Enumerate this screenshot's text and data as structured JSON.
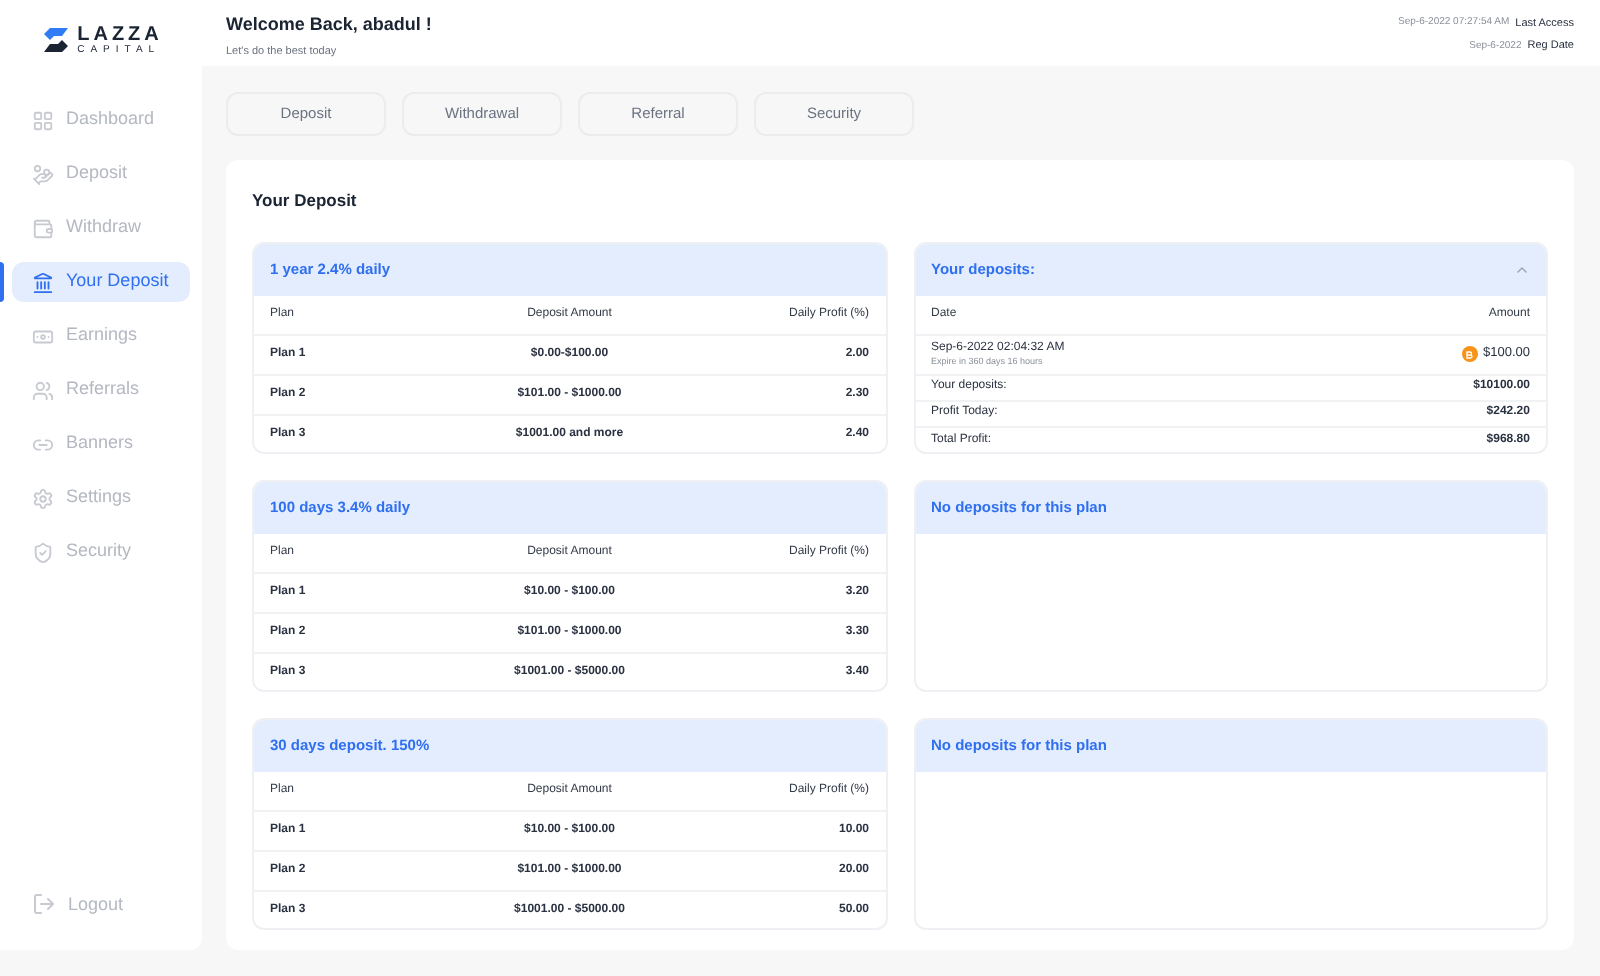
{
  "logo": {
    "name": "LAZZA",
    "tagline": "CAPITAL"
  },
  "header": {
    "title": "Welcome Back, abadul !",
    "subtitle": "Let's do the best today",
    "meta": [
      {
        "value": "Sep-6-2022 07:27:54 AM",
        "label": "Last Access"
      },
      {
        "value": "Sep-6-2022",
        "label": "Reg Date"
      }
    ]
  },
  "sidebar": {
    "items": [
      {
        "label": "Dashboard",
        "selected": false
      },
      {
        "label": "Deposit",
        "selected": false
      },
      {
        "label": "Withdraw",
        "selected": false
      },
      {
        "label": "Your Deposit",
        "selected": true
      },
      {
        "label": "Earnings",
        "selected": false
      },
      {
        "label": "Referrals",
        "selected": false
      },
      {
        "label": "Banners",
        "selected": false
      },
      {
        "label": "Settings",
        "selected": false
      },
      {
        "label": "Security",
        "selected": false
      }
    ],
    "logout": "Logout"
  },
  "tabs": [
    {
      "label": "Deposit",
      "selected": false
    },
    {
      "label": "Withdrawal",
      "selected": false
    },
    {
      "label": "Referral",
      "selected": false
    },
    {
      "label": "Security",
      "selected": false
    }
  ],
  "section_title": "Your Deposit",
  "plans": [
    {
      "title": "1 year 2.4% daily",
      "columns": [
        "Plan",
        "Deposit Amount",
        "Daily Profit (%)"
      ],
      "rows": [
        [
          "Plan 1",
          "$0.00-$100.00",
          "2.00"
        ],
        [
          "Plan 2",
          "$101.00 - $1000.00",
          "2.30"
        ],
        [
          "Plan 3",
          "$1001.00 and more",
          "2.40"
        ]
      ],
      "deposits": {
        "kind": "list",
        "title": "Your deposits:",
        "expanded": true,
        "columns": [
          "Date",
          "Amount"
        ],
        "entry": {
          "date": "Sep-6-2022 02:04:32 AM",
          "note": "Expire in 360 days 16 hours",
          "amount": "$100.00"
        },
        "summary": [
          {
            "label": "Your deposits:",
            "value": "$10100.00"
          },
          {
            "label": "Profit Today:",
            "value": "$242.20"
          },
          {
            "label": "Total Profit:",
            "value": "$968.80"
          }
        ]
      }
    },
    {
      "title": "100 days 3.4% daily",
      "columns": [
        "Plan",
        "Deposit Amount",
        "Daily Profit (%)"
      ],
      "rows": [
        [
          "Plan 1",
          "$10.00 - $100.00",
          "3.20"
        ],
        [
          "Plan 2",
          "$101.00 - $1000.00",
          "3.30"
        ],
        [
          "Plan 3",
          "$1001.00 - $5000.00",
          "3.40"
        ]
      ],
      "deposits": {
        "kind": "empty",
        "title": "No deposits for this plan"
      }
    },
    {
      "title": "30 days deposit. 150%",
      "columns": [
        "Plan",
        "Deposit Amount",
        "Daily Profit (%)"
      ],
      "rows": [
        [
          "Plan 1",
          "$10.00 - $100.00",
          "10.00"
        ],
        [
          "Plan 2",
          "$101.00 - $1000.00",
          "20.00"
        ],
        [
          "Plan 3",
          "$1001.00 - $5000.00",
          "50.00"
        ]
      ],
      "deposits": {
        "kind": "empty",
        "title": "No deposits for this plan"
      }
    }
  ]
}
